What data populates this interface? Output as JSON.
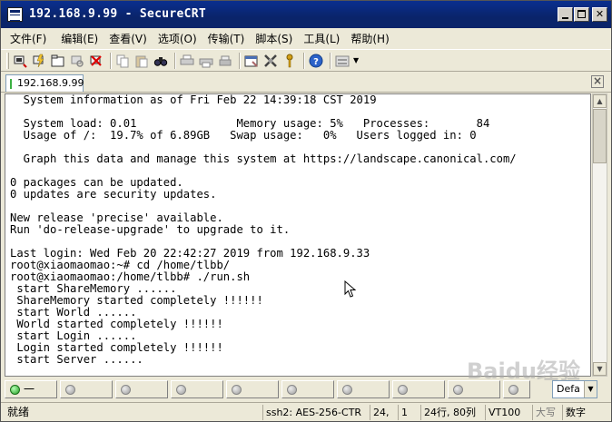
{
  "window": {
    "title": "192.168.9.99 - SecureCRT"
  },
  "menu": {
    "items": [
      "文件(F)",
      "编辑(E)",
      "查看(V)",
      "选项(O)",
      "传输(T)",
      "脚本(S)",
      "工具(L)",
      "帮助(H)"
    ]
  },
  "toolbar": {
    "icons": [
      "connect-icon",
      "quick-connect-icon",
      "connect-in-tab-icon",
      "reconnect-icon",
      "disconnect-icon",
      "copy-icon",
      "paste-icon",
      "find-icon",
      "print-icon",
      "print-selection-icon",
      "printer-icon",
      "session-options-icon",
      "global-options-icon",
      "keymap-icon",
      "help-icon",
      "sftp-icon"
    ]
  },
  "tabs": {
    "session_label": "192.168.9.99",
    "close_label": "×"
  },
  "terminal": {
    "lines": [
      "  System information as of Fri Feb 22 14:39:18 CST 2019",
      "",
      "  System load: 0.01               Memory usage: 5%   Processes:       84",
      "  Usage of /:  19.7% of 6.89GB   Swap usage:   0%   Users logged in: 0",
      "",
      "  Graph this data and manage this system at https://landscape.canonical.com/",
      "",
      "0 packages can be updated.",
      "0 updates are security updates.",
      "",
      "New release 'precise' available.",
      "Run 'do-release-upgrade' to upgrade to it.",
      "",
      "Last login: Wed Feb 20 22:42:27 2019 from 192.168.9.33",
      "root@xiaomaomao:~# cd /home/tlbb/",
      "root@xiaomaomao:/home/tlbb# ./run.sh",
      " start ShareMemory ......",
      " ShareMemory started completely !!!!!!",
      " start World ......",
      " World started completely !!!!!!",
      " start Login ......",
      " Login started completely !!!!!!",
      " start Server ......"
    ]
  },
  "buttonbar": {
    "first_label": "一",
    "select_value": "Defa"
  },
  "statusbar": {
    "ready": "就绪",
    "protocol": "ssh2: AES-256-CTR",
    "row": "24,",
    "col": "1",
    "rows_cols": "24行, 80列",
    "terminal_type": "VT100",
    "caps": "大写",
    "num": "数字"
  },
  "watermark": "Baidu经验"
}
